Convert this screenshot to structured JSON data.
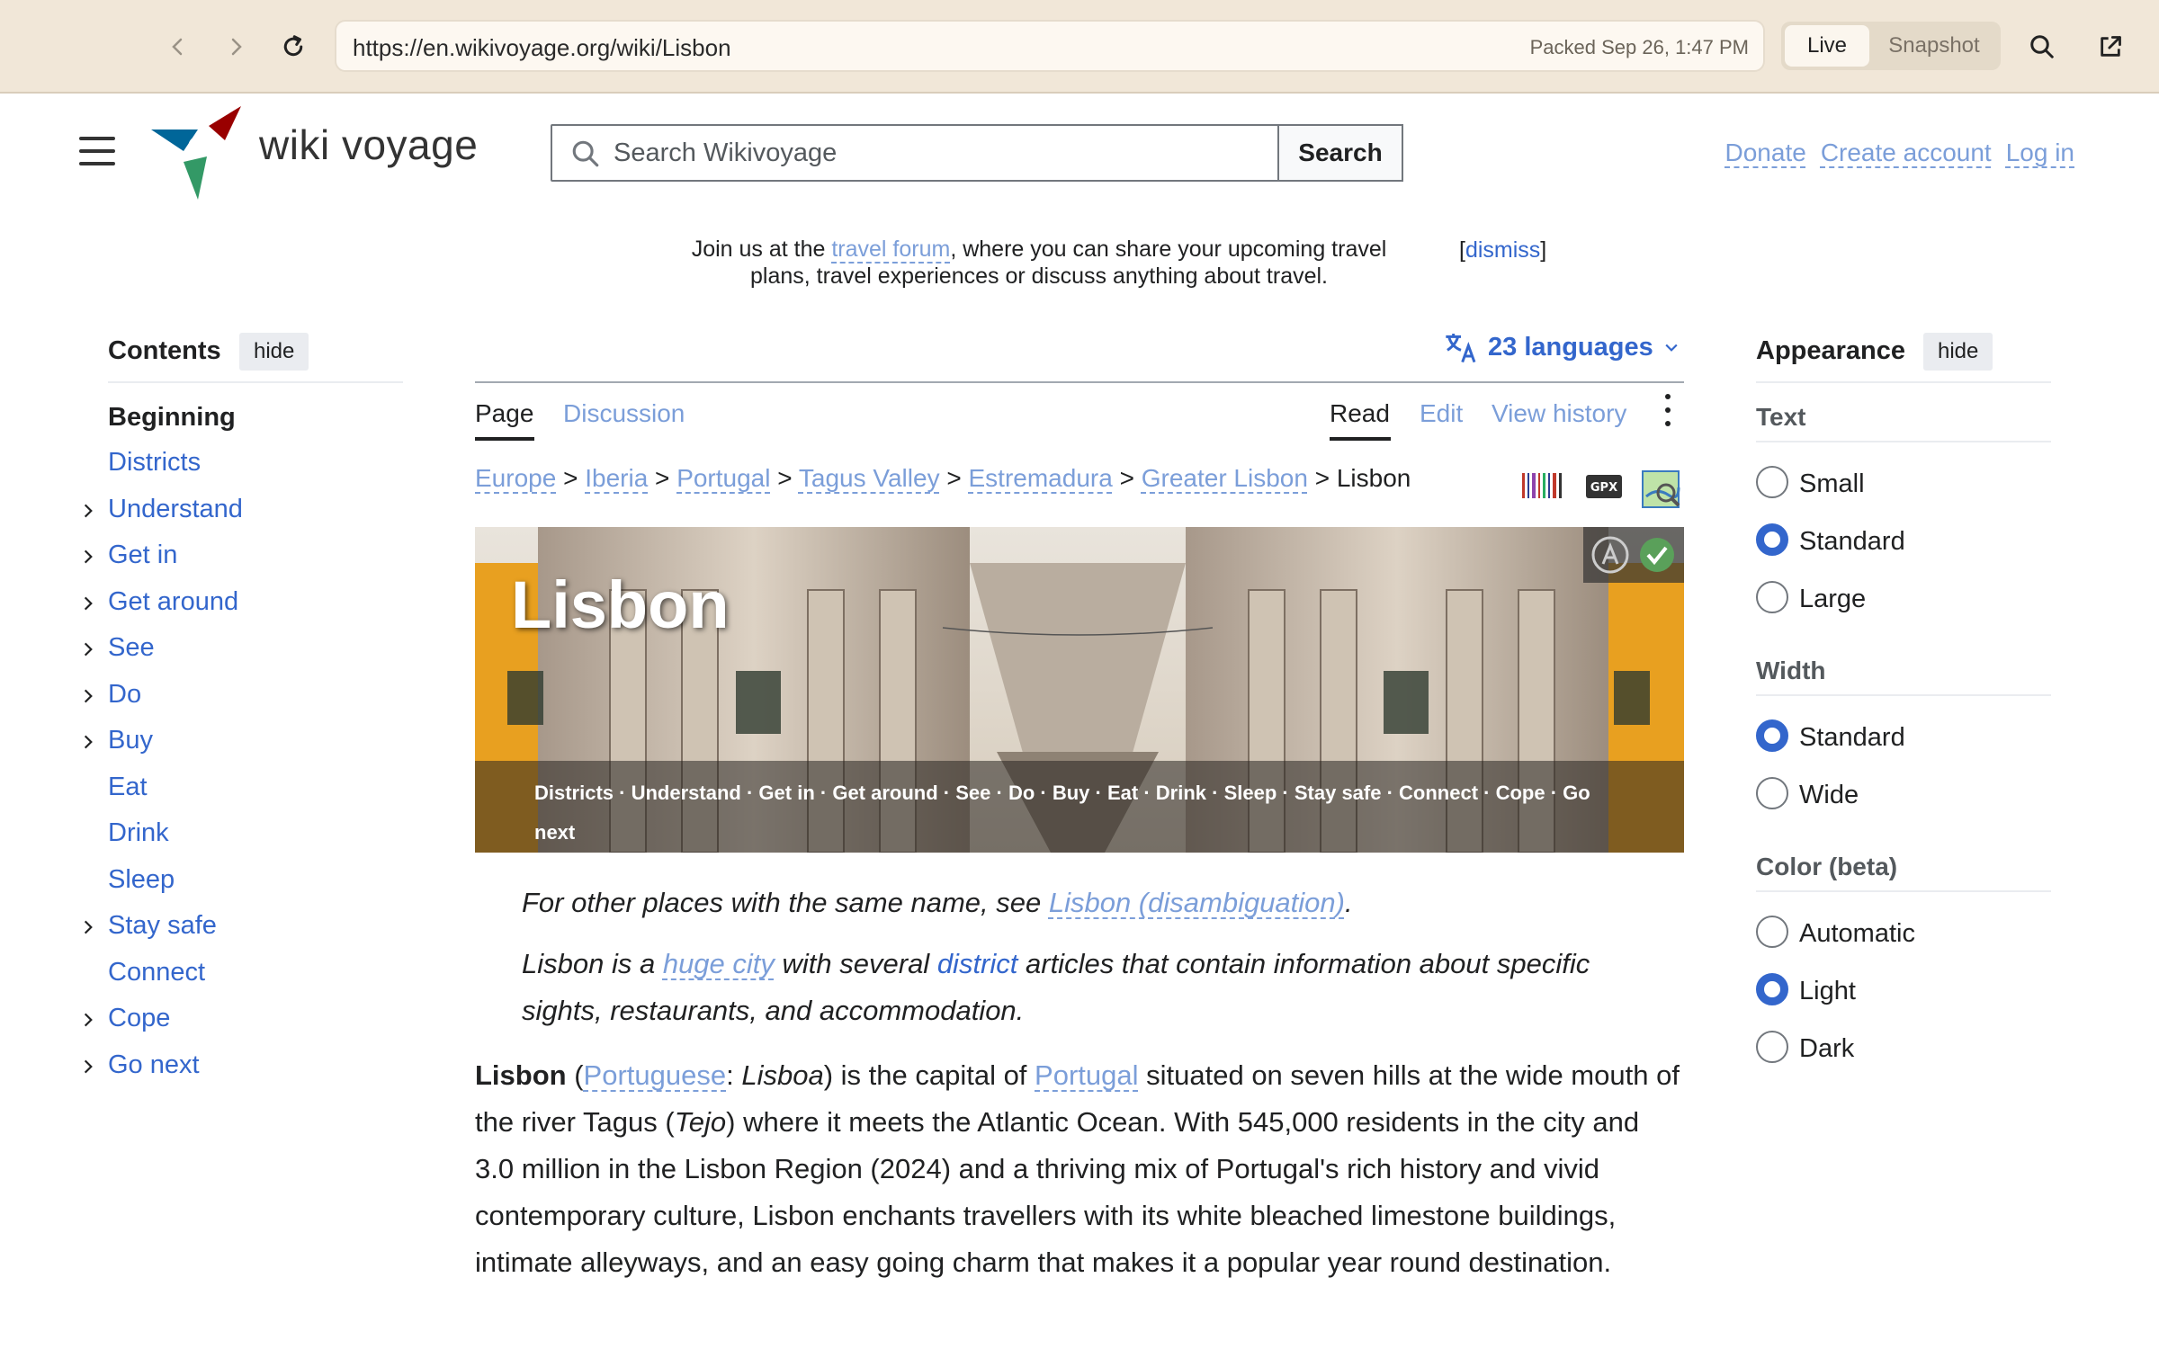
{
  "browser": {
    "url": "https://en.wikivoyage.org/wiki/Lisbon",
    "packed": "Packed Sep 26, 1:47 PM",
    "live_label": "Live",
    "snapshot_label": "Snapshot"
  },
  "header": {
    "wordmark": "wiki voyage",
    "search_placeholder": "Search Wikivoyage",
    "search_button": "Search",
    "donate": "Donate",
    "create_account": "Create account",
    "login": "Log in"
  },
  "notice": {
    "pre": "Join us at the ",
    "link": "travel forum",
    "post": ", where you can share your upcoming travel plans, travel experiences or discuss anything about travel.",
    "dismiss": "dismiss"
  },
  "toc": {
    "title": "Contents",
    "hide": "hide",
    "beginning": "Beginning",
    "items": [
      "Districts",
      "Understand",
      "Get in",
      "Get around",
      "See",
      "Do",
      "Buy",
      "Eat",
      "Drink",
      "Sleep",
      "Stay safe",
      "Connect",
      "Cope",
      "Go next"
    ]
  },
  "appearance": {
    "title": "Appearance",
    "hide": "hide",
    "text_head": "Text",
    "text_opts": [
      "Small",
      "Standard",
      "Large"
    ],
    "width_head": "Width",
    "width_opts": [
      "Standard",
      "Wide"
    ],
    "color_head": "Color (beta)",
    "color_opts": [
      "Automatic",
      "Light",
      "Dark"
    ]
  },
  "tabs": {
    "languages": "23 languages",
    "page": "Page",
    "discussion": "Discussion",
    "read": "Read",
    "edit": "Edit",
    "history": "View history"
  },
  "breadcrumb": [
    "Europe",
    "Iberia",
    "Portugal",
    "Tagus Valley",
    "Estremadura",
    "Greater Lisbon",
    "Lisbon"
  ],
  "banner": {
    "title": "Lisbon",
    "nav": [
      "Districts",
      "Understand",
      "Get in",
      "Get around",
      "See",
      "Do",
      "Buy",
      "Eat",
      "Drink",
      "Sleep",
      "Stay safe",
      "Connect",
      "Cope",
      "Go next"
    ]
  },
  "content": {
    "hat1_pre": "For other places with the same name, see ",
    "hat1_link": "Lisbon (disambiguation)",
    "hat1_post": ".",
    "hat2_pre": "Lisbon is a ",
    "hat2_link1": "huge city",
    "hat2_mid": " with several ",
    "hat2_link2": "district",
    "hat2_post": " articles that contain information about specific sights, restaurants, and accommodation.",
    "lead_bold": "Lisbon",
    "lead_p1": " (",
    "lead_link1": "Portuguese",
    "lead_p2": ": ",
    "lead_italic1": "Lisboa",
    "lead_p3": ") is the capital of ",
    "lead_link2": "Portugal",
    "lead_p4": " situated on seven hills at the wide mouth of the river Tagus (",
    "lead_italic2": "Tejo",
    "lead_p5": ") where it meets the Atlantic Ocean. With 545,000 residents in the city and 3.0 million in the Lisbon Region (2024) and a thriving mix of Portugal's rich history and vivid contemporary culture, Lisbon enchants travellers with its white bleached limestone buildings, intimate alleyways, and an easy going charm that makes it a popular year round destination."
  }
}
